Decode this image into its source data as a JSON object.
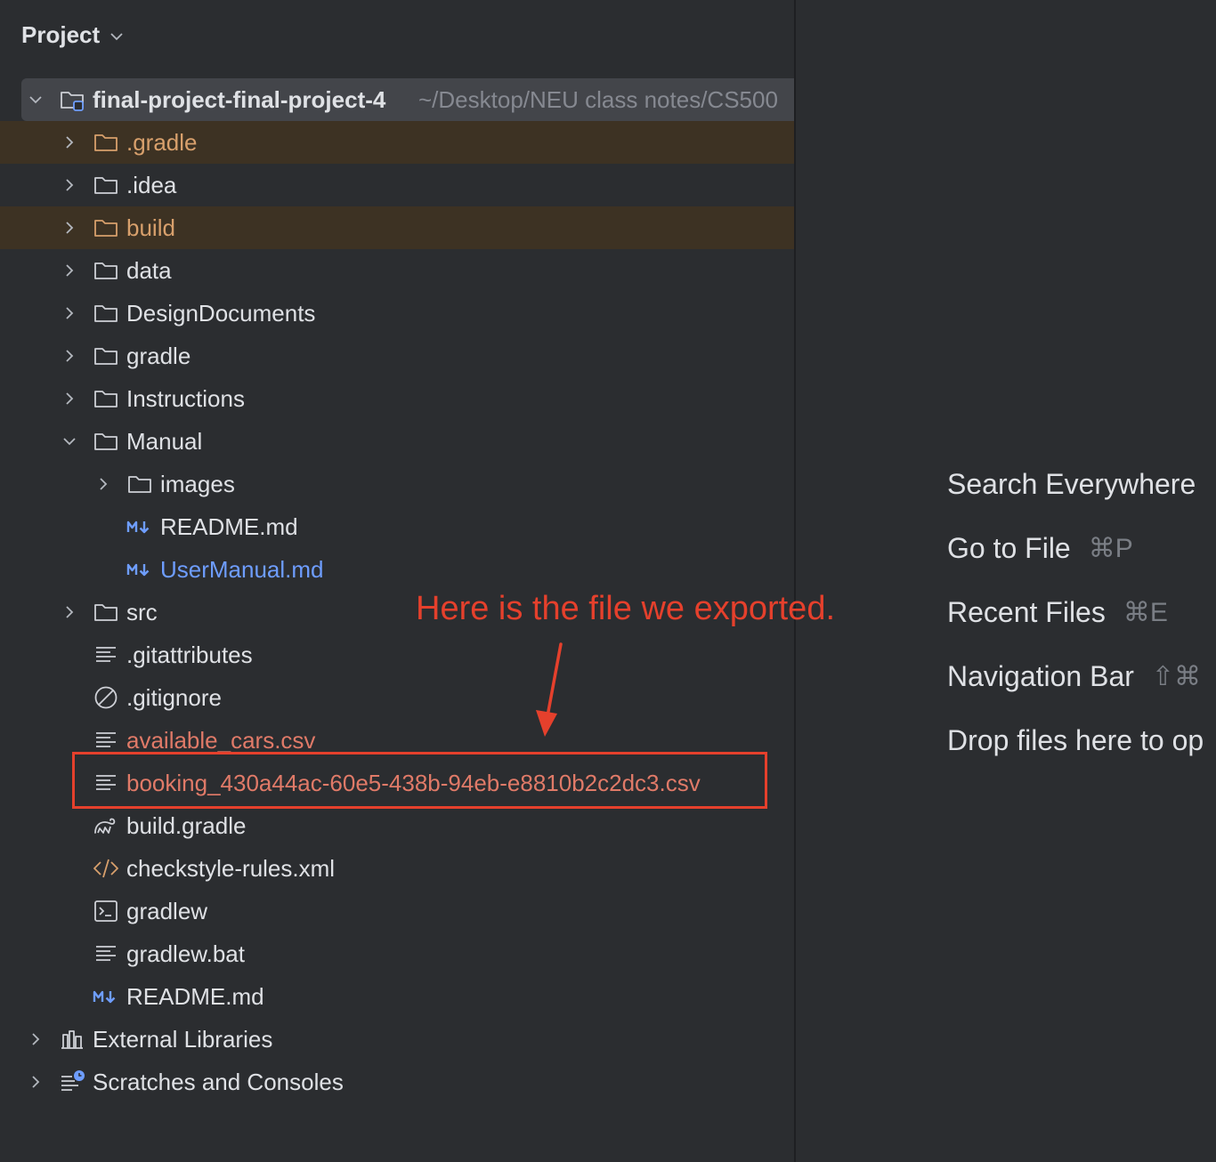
{
  "panel": {
    "title": "Project",
    "root": {
      "name": "final-project-final-project-4",
      "path": "~/Desktop/NEU class notes/CS500"
    },
    "items": [
      {
        "label": ".gradle",
        "type": "folder",
        "color": "orange"
      },
      {
        "label": ".idea",
        "type": "folder"
      },
      {
        "label": "build",
        "type": "folder",
        "color": "orange"
      },
      {
        "label": "data",
        "type": "folder"
      },
      {
        "label": "DesignDocuments",
        "type": "folder"
      },
      {
        "label": "gradle",
        "type": "folder"
      },
      {
        "label": "Instructions",
        "type": "folder"
      },
      {
        "label": "Manual",
        "type": "folder",
        "expanded": true
      },
      {
        "label": "images",
        "type": "folder"
      },
      {
        "label": "README.md",
        "type": "markdown"
      },
      {
        "label": "UserManual.md",
        "type": "markdown",
        "color": "blue"
      },
      {
        "label": "src",
        "type": "folder"
      },
      {
        "label": ".gitattributes",
        "type": "text"
      },
      {
        "label": ".gitignore",
        "type": "ignore"
      },
      {
        "label": "available_cars.csv",
        "type": "text",
        "color": "red"
      },
      {
        "label": "booking_430a44ac-60e5-438b-94eb-e8810b2c2dc3.csv",
        "type": "text",
        "color": "red"
      },
      {
        "label": "build.gradle",
        "type": "gradle"
      },
      {
        "label": "checkstyle-rules.xml",
        "type": "xml"
      },
      {
        "label": "gradlew",
        "type": "shell"
      },
      {
        "label": "gradlew.bat",
        "type": "text"
      },
      {
        "label": "README.md",
        "type": "markdown"
      }
    ],
    "bottom_items": [
      {
        "label": "External Libraries"
      },
      {
        "label": "Scratches and Consoles"
      }
    ]
  },
  "annotation": {
    "text": "Here is the file we exported."
  },
  "editor": {
    "actions": [
      {
        "label": "Search Everywhere",
        "shortcut": ""
      },
      {
        "label": "Go to File",
        "shortcut": "⌘P"
      },
      {
        "label": "Recent Files",
        "shortcut": "⌘E"
      },
      {
        "label": "Navigation Bar",
        "shortcut": "⇧⌘"
      },
      {
        "label": "Drop files here to op",
        "shortcut": ""
      }
    ]
  },
  "colors": {
    "background": "#2b2d30",
    "excluded_row": "#3d3223",
    "selected_row": "#43454a",
    "orange_text": "#d8a06c",
    "blue_text": "#6e9dff",
    "red_text": "#e07a68",
    "annotation": "#e5402c"
  }
}
